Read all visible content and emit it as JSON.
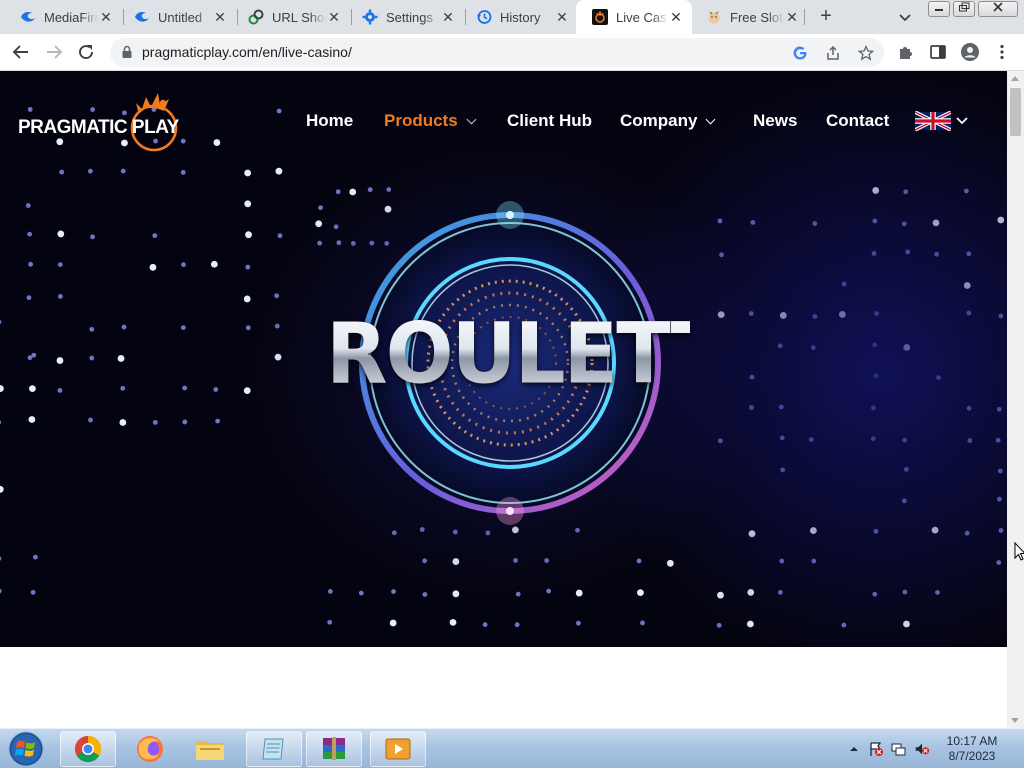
{
  "browser": {
    "tabs": [
      {
        "title": "MediaFire",
        "icon": "mediafire-icon",
        "active": false
      },
      {
        "title": "Untitled",
        "icon": "mediafire-icon",
        "active": false
      },
      {
        "title": "URL Shortener",
        "icon": "link-icon",
        "active": false
      },
      {
        "title": "Settings",
        "icon": "gear-icon",
        "active": false
      },
      {
        "title": "History",
        "icon": "history-icon",
        "active": false
      },
      {
        "title": "Live Casino",
        "icon": "pragmatic-play-icon",
        "active": true
      },
      {
        "title": "Free Slots",
        "icon": "slot-icon",
        "active": false
      }
    ],
    "new_tab_label": "+",
    "close_glyph": "✕",
    "address": {
      "url": "pragmaticplay.com/en/live-casino/"
    }
  },
  "site": {
    "logo": {
      "text": "PRAGMATIC PLAY"
    },
    "nav": [
      {
        "label": "Home",
        "dropdown": false,
        "active": false
      },
      {
        "label": "Products",
        "dropdown": true,
        "active": true
      },
      {
        "label": "Client Hub",
        "dropdown": false,
        "active": false
      },
      {
        "label": "Company",
        "dropdown": true,
        "active": false
      },
      {
        "label": "News",
        "dropdown": false,
        "active": false
      },
      {
        "label": "Contact",
        "dropdown": false,
        "active": false
      }
    ],
    "language_flag": "uk-flag-icon",
    "hero": {
      "title": "ROULETTE"
    },
    "colors": {
      "accent": "#f47a20",
      "hero_bg": "#040410",
      "ring": "#5ad8ff"
    }
  },
  "taskbar": {
    "apps": [
      "chrome-icon",
      "firefox-icon",
      "file-explorer-icon",
      "notepad-icon",
      "winrar-icon",
      "media-player-icon"
    ],
    "clock": {
      "time": "10:17 AM",
      "date": "8/7/2023"
    }
  }
}
